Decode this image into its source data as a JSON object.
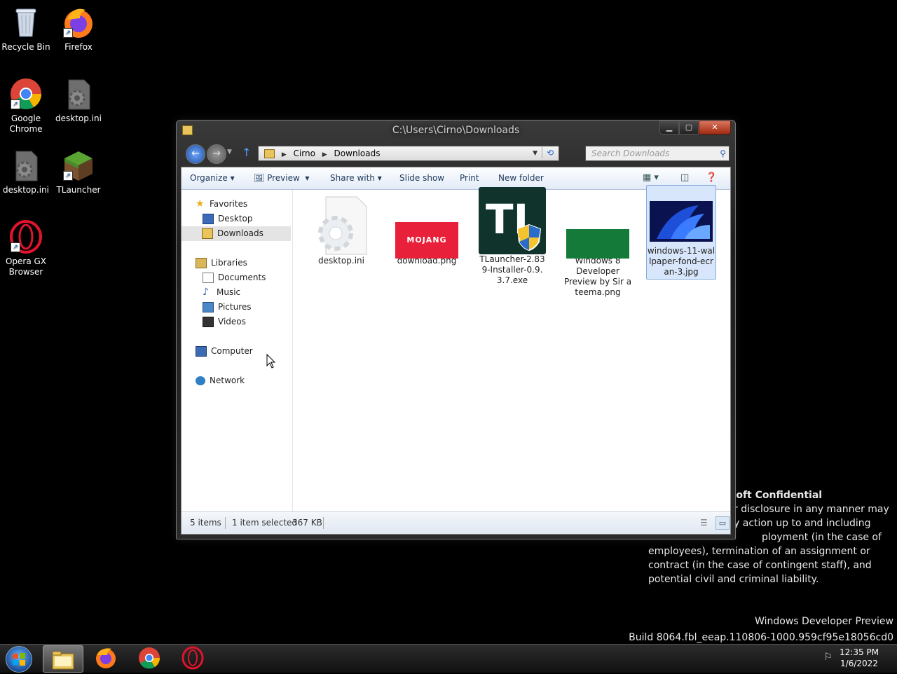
{
  "desktop": {
    "icons": [
      {
        "label": "Recycle Bin",
        "icon": "recycle-bin-icon"
      },
      {
        "label": "Firefox",
        "icon": "firefox-icon"
      },
      {
        "label": "Google Chrome",
        "icon": "chrome-icon"
      },
      {
        "label": "desktop.ini",
        "icon": "settings-file-icon"
      },
      {
        "label": "desktop.ini",
        "icon": "settings-file-icon"
      },
      {
        "label": "TLauncher",
        "icon": "grass-block-icon"
      },
      {
        "label": "Opera GX Browser",
        "icon": "opera-icon"
      }
    ]
  },
  "watermark": {
    "title": "soft Confidential",
    "line1": "r disclosure in any manner may",
    "line2": "y action up to and including",
    "line3": "ployment (in the case of",
    "line4": "employees), termination of an assignment or",
    "line5": "contract (in the case of contingent staff), and",
    "line6": "potential civil and criminal liability.",
    "build1": "Windows Developer Preview",
    "build2": "Build 8064.fbl_eeap.110806-1000.959cf95e18056cd0"
  },
  "window": {
    "title": "C:\\Users\\Cirno\\Downloads",
    "address": {
      "crumbs": [
        "Cirno",
        "Downloads"
      ]
    },
    "search_placeholder": "Search Downloads",
    "toolbar": {
      "organize": "Organize",
      "preview": "Preview",
      "share": "Share with",
      "slideshow": "Slide show",
      "print": "Print",
      "new_folder": "New folder"
    },
    "nav": {
      "favorites": "Favorites",
      "desktop": "Desktop",
      "downloads": "Downloads",
      "libraries": "Libraries",
      "documents": "Documents",
      "music": "Music",
      "pictures": "Pictures",
      "videos": "Videos",
      "computer": "Computer",
      "network": "Network"
    },
    "files": [
      {
        "name": "desktop.ini"
      },
      {
        "name": "download.png"
      },
      {
        "name": "TLauncher-2.839-Installer-0.9.3.7.exe"
      },
      {
        "name": "Windows 8 Developer Preview by Sir a teema.png"
      },
      {
        "name": "windows-11-wallpaper-fond-ecran-3.jpg"
      }
    ],
    "status": {
      "items": "5 items",
      "selected": "1 item selected",
      "size": "367 KB"
    }
  },
  "taskbar": {
    "time": "12:35 PM",
    "date": "1/6/2022"
  },
  "colors": {
    "accent": "#1e4e9c",
    "selection": "#d8e6fb",
    "desktop_bg": "#000000"
  }
}
